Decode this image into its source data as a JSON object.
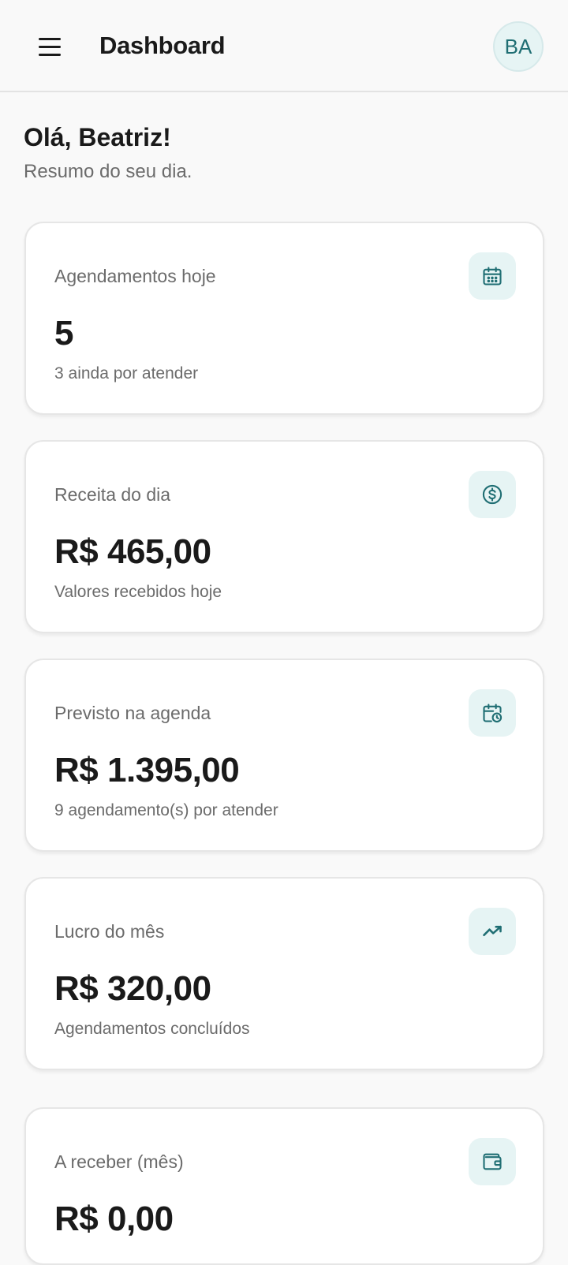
{
  "header": {
    "title": "Dashboard",
    "avatar_initials": "BA"
  },
  "greeting": {
    "title": "Olá, Beatriz!",
    "subtitle": "Resumo do seu dia."
  },
  "cards": [
    {
      "label": "Agendamentos hoje",
      "value": "5",
      "caption": "3 ainda por atender",
      "icon": "calendar-icon"
    },
    {
      "label": "Receita do dia",
      "value": "R$ 465,00",
      "caption": "Valores recebidos hoje",
      "icon": "dollar-circle-icon"
    },
    {
      "label": "Previsto na agenda",
      "value": "R$ 1.395,00",
      "caption": "9 agendamento(s) por atender",
      "icon": "calendar-clock-icon"
    },
    {
      "label": "Lucro do mês",
      "value": "R$ 320,00",
      "caption": "Agendamentos concluídos",
      "icon": "trending-up-icon"
    },
    {
      "label": "A receber (mês)",
      "value": "R$ 0,00",
      "caption": "",
      "icon": "wallet-icon"
    }
  ],
  "colors": {
    "accent": "#1f6e73",
    "accent_bg": "#e6f4f4",
    "background": "#f9f9f9"
  }
}
